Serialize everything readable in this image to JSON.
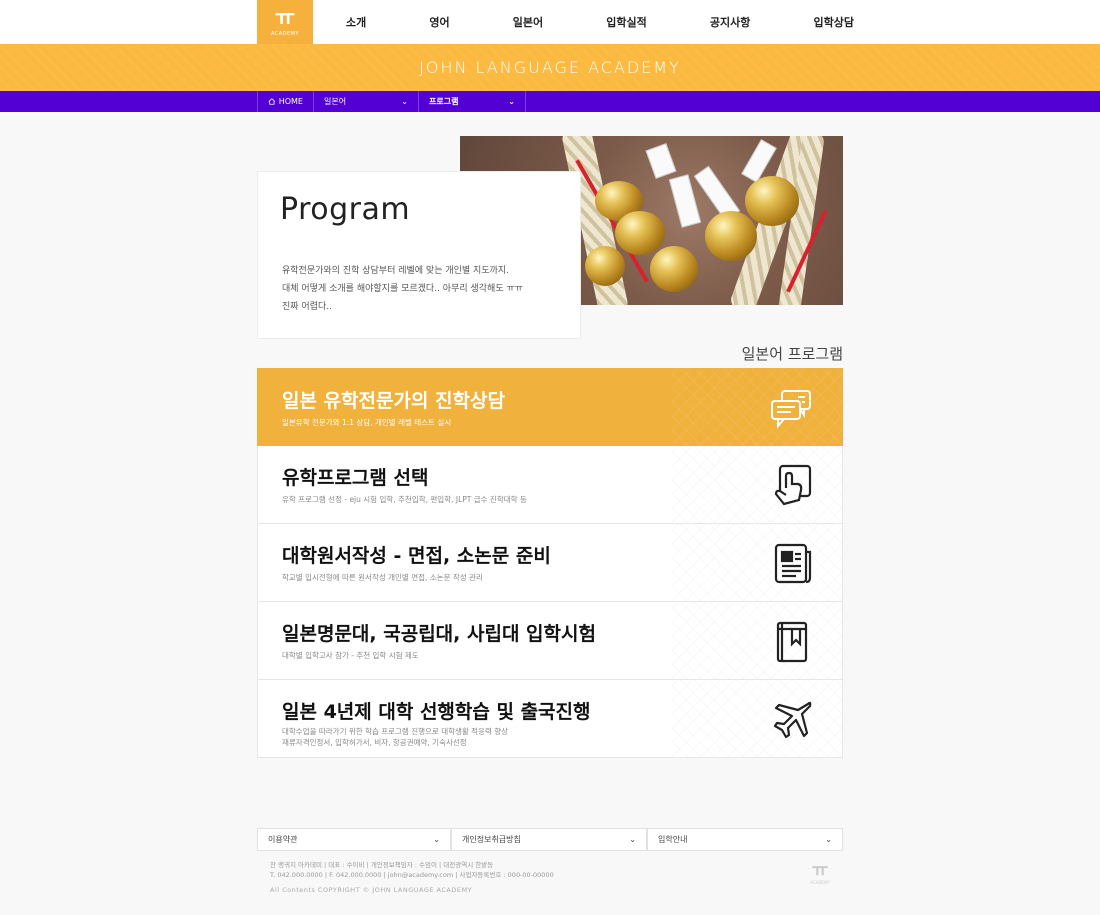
{
  "logo": {
    "mark": "ㅠ",
    "word": "ACADEMY"
  },
  "nav": [
    "소개",
    "영어",
    "일본어",
    "입학실적",
    "공지사항",
    "입학상담"
  ],
  "banner": "JOHN LANGUAGE ACADEMY",
  "location": {
    "home": "HOME",
    "level1": "일본어",
    "level2": "프로그램"
  },
  "intro": {
    "title": "Program",
    "lines": [
      "유학전문가와의 진학 상담부터 레벨에 맞는 개인별 지도까지.",
      "대체 어떻게 소개를 해야할지를 모르겠다.. 아무리 생각해도 ㅠㅠ",
      "진짜 어렵다.."
    ]
  },
  "section_title": "일본어 프로그램",
  "programs": [
    {
      "title": "일본 유학전문가의 진학상담",
      "sub": [
        "일본유학 전문가와 1:1 상담, 개인별 레벨 테스트 실시"
      ],
      "icon": "chat-bubbles-icon"
    },
    {
      "title": "유학프로그램 선택",
      "sub": [
        "유학 프로그램 선정 - eju 시험 입학, 추천입학, 편입학, JLPT 급수 진학대학 등"
      ],
      "icon": "touch-select-icon"
    },
    {
      "title": "대학원서작성 - 면접, 소논문 준비",
      "sub": [
        "학교별 입시전형에 따른 원서작성 개인별 면접, 소논문 작성 관리"
      ],
      "icon": "document-icon"
    },
    {
      "title": "일본명문대, 국공립대, 사립대 입학시험",
      "sub": [
        "대학별 입학고사 참가 - 추천 입학 시험 제도"
      ],
      "icon": "book-icon"
    },
    {
      "title": "일본 4년제 대학 선행학습 및 출국진행",
      "sub": [
        "대학수업을 따라가기 위한 학습 프로그램 진행으로 대학생활 적응력 향상",
        "재류자격인정서, 입학허가서, 비자, 항공권예약, 기숙사선정"
      ],
      "icon": "airplane-icon"
    }
  ],
  "footer": {
    "selects": [
      "이용약관",
      "개인정보취급방침",
      "입학안내"
    ],
    "info1": "잔 랭귀지 아카데미  |  대표 : 수이비  |  개인정보책임자 : 수엄이  |  대전광역시 한밭동",
    "info2": "T. 042.000.0000  |  F. 042.000.0000  |  john@academy.com  |  사업자등록번호 : 000-00-00000",
    "copyright": "All Contents COPYRIGHT © JOHN LANGUAGE ACADEMY"
  },
  "colors": {
    "accent": "#f0b13d",
    "banner": "#fbb93f",
    "location_bar": "#5200d4"
  }
}
